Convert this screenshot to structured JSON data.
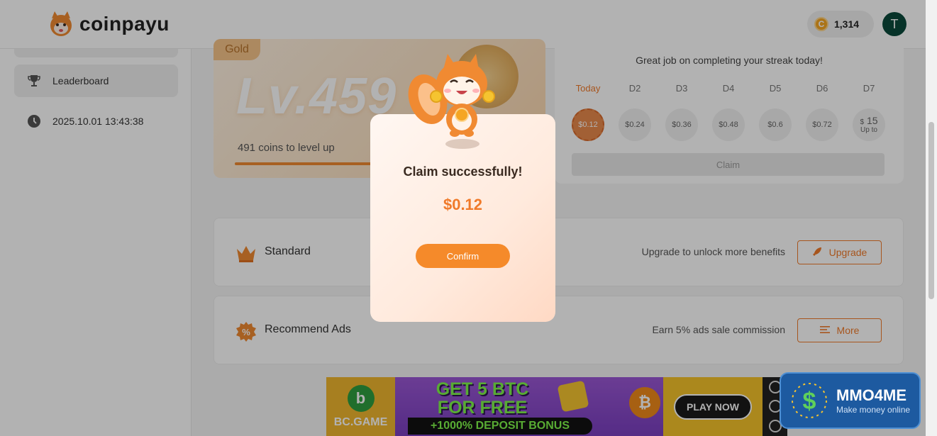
{
  "header": {
    "brand": "coinpayu",
    "coin_glyph": "C",
    "coin_balance": "1,314",
    "avatar_initial": "T"
  },
  "sidebar": {
    "items": [
      {
        "label": "Leaderboard",
        "icon": "trophy-icon",
        "active": true
      },
      {
        "label": "2025.10.01 13:43:38",
        "icon": "clock-icon",
        "active": false
      }
    ]
  },
  "level_card": {
    "tier": "Gold",
    "level": "Lv.459",
    "levelup_text": "491 coins to level up",
    "progress": 0.47
  },
  "streak": {
    "message": "Great job on completing your streak today!",
    "days": [
      {
        "label": "Today",
        "amount": "$0.12"
      },
      {
        "label": "D2",
        "amount": "$0.24"
      },
      {
        "label": "D3",
        "amount": "$0.36"
      },
      {
        "label": "D4",
        "amount": "$0.48"
      },
      {
        "label": "D5",
        "amount": "$0.6"
      },
      {
        "label": "D6",
        "amount": "$0.72"
      },
      {
        "label": "D7",
        "amount_prefix": "$",
        "amount": "15",
        "amount_suffix": "Up to"
      }
    ],
    "claim_label": "Claim"
  },
  "rows": [
    {
      "title": "Standard",
      "description": "Upgrade to unlock more benefits",
      "button": "Upgrade",
      "icon": "crown-icon",
      "button_icon": "rocket-icon"
    },
    {
      "title": "Recommend Ads",
      "description": "Earn 5% ads sale commission",
      "button": "More",
      "icon": "percent-badge-icon",
      "button_icon": "list-icon"
    }
  ],
  "ad": {
    "brand": "BC.GAME",
    "brand_glyph": "b",
    "headline": "GET 5 BTC FOR FREE",
    "bonus": "+1000% DEPOSIT BONUS",
    "btc_glyph": "₿",
    "cta": "PLAY NOW"
  },
  "modal": {
    "title": "Claim successfully!",
    "amount": "$0.12",
    "confirm_label": "Confirm"
  },
  "watermark": {
    "title": "MMO4ME",
    "subtitle": "Make money online"
  },
  "colors": {
    "accent": "#f07a2a",
    "overlay": "rgba(0,0,0,0.30)",
    "avatar": "#0b4a3c"
  }
}
